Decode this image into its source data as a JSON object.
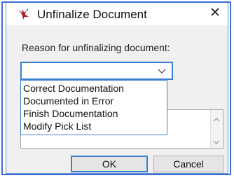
{
  "dialog": {
    "title": "Unfinalize Document",
    "close_glyph": "✕",
    "reason_label": "Reason for unfinalizing document:",
    "reason_selected": "",
    "reason_options": [
      "Correct Documentation",
      "Documented in Error",
      "Finish Documentation",
      "Modify Pick List"
    ],
    "ok_label": "OK",
    "cancel_label": "Cancel"
  },
  "icons": {
    "app": "red-bird-logo-icon",
    "close": "close-icon",
    "dropdown": "chevron-down-icon",
    "scroll_up": "scroll-up-arrow-icon",
    "scroll_down": "scroll-down-arrow-icon"
  },
  "colors": {
    "accent": "#3c7fd0",
    "icon_red": "#b01e2e",
    "dialog_bg": "#f0f0f0"
  }
}
